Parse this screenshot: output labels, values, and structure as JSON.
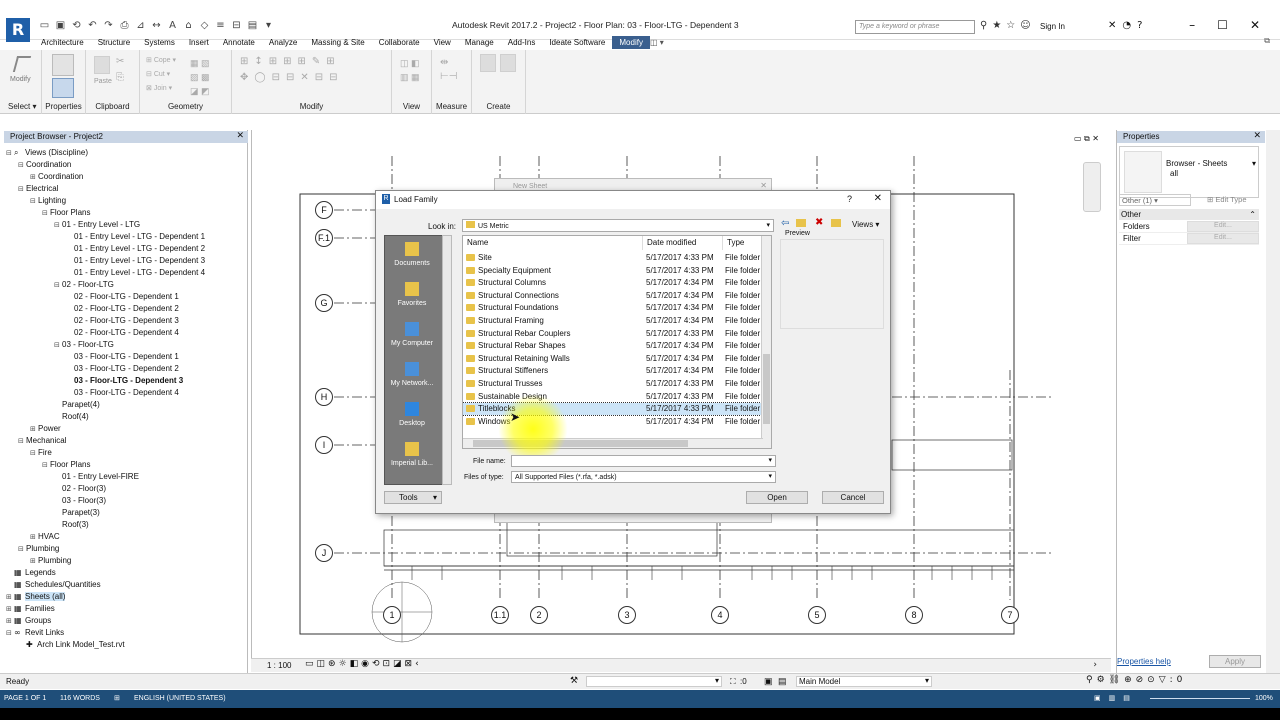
{
  "app": {
    "logo": "R",
    "window_title": "Autodesk Revit 2017.2 -     Project2 - Floor Plan: 03 - Floor-LTG - Dependent 3",
    "search_placeholder": "Type a keyword or phrase",
    "sign_in": "Sign In"
  },
  "tabs": [
    "Architecture",
    "Structure",
    "Systems",
    "Insert",
    "Annotate",
    "Analyze",
    "Massing & Site",
    "Collaborate",
    "View",
    "Manage",
    "Add-Ins",
    "Ideate Software",
    "Modify"
  ],
  "active_tab": "Modify",
  "ribbon": {
    "groups": [
      "Select",
      "Properties",
      "Clipboard",
      "Geometry",
      "Modify",
      "View",
      "Measure",
      "Create"
    ],
    "modify_button": "Modify",
    "paste": "Paste",
    "cope": "Cope",
    "cut": "Cut",
    "join": "Join"
  },
  "project_browser": {
    "title": "Project Browser - Project2",
    "items": [
      {
        "t": "Views (Discipline)",
        "lvl": 0,
        "exp": "−",
        "icon": "views"
      },
      {
        "t": "Coordination",
        "lvl": 1,
        "exp": "−"
      },
      {
        "t": "Coordination",
        "lvl": 2,
        "exp": "+"
      },
      {
        "t": "Electrical",
        "lvl": 1,
        "exp": "−"
      },
      {
        "t": "Lighting",
        "lvl": 2,
        "exp": "−"
      },
      {
        "t": "Floor Plans",
        "lvl": 3,
        "exp": "−"
      },
      {
        "t": "01 - Entry Level - LTG",
        "lvl": 4,
        "exp": "−"
      },
      {
        "t": "01 - Entry Level - LTG - Dependent 1",
        "lvl": 5,
        "exp": ""
      },
      {
        "t": "01 - Entry Level - LTG - Dependent 2",
        "lvl": 5,
        "exp": ""
      },
      {
        "t": "01 - Entry Level - LTG - Dependent 3",
        "lvl": 5,
        "exp": ""
      },
      {
        "t": "01 - Entry Level - LTG - Dependent 4",
        "lvl": 5,
        "exp": ""
      },
      {
        "t": "02 - Floor-LTG",
        "lvl": 4,
        "exp": "−"
      },
      {
        "t": "02 - Floor-LTG - Dependent 1",
        "lvl": 5,
        "exp": ""
      },
      {
        "t": "02 - Floor-LTG - Dependent 2",
        "lvl": 5,
        "exp": ""
      },
      {
        "t": "02 - Floor-LTG - Dependent 3",
        "lvl": 5,
        "exp": ""
      },
      {
        "t": "02 - Floor-LTG - Dependent 4",
        "lvl": 5,
        "exp": ""
      },
      {
        "t": "03 - Floor-LTG",
        "lvl": 4,
        "exp": "−"
      },
      {
        "t": "03 - Floor-LTG - Dependent 1",
        "lvl": 5,
        "exp": ""
      },
      {
        "t": "03 - Floor-LTG - Dependent 2",
        "lvl": 5,
        "exp": ""
      },
      {
        "t": "03 - Floor-LTG - Dependent 3",
        "lvl": 5,
        "exp": "",
        "bold": true
      },
      {
        "t": "03 - Floor-LTG - Dependent 4",
        "lvl": 5,
        "exp": ""
      },
      {
        "t": "Parapet(4)",
        "lvl": 4,
        "exp": ""
      },
      {
        "t": "Roof(4)",
        "lvl": 4,
        "exp": ""
      },
      {
        "t": "Power",
        "lvl": 2,
        "exp": "+"
      },
      {
        "t": "Mechanical",
        "lvl": 1,
        "exp": "−"
      },
      {
        "t": "Fire",
        "lvl": 2,
        "exp": "−"
      },
      {
        "t": "Floor Plans",
        "lvl": 3,
        "exp": "−"
      },
      {
        "t": "01 - Entry Level-FIRE",
        "lvl": 4,
        "exp": ""
      },
      {
        "t": "02 - Floor(3)",
        "lvl": 4,
        "exp": ""
      },
      {
        "t": "03 - Floor(3)",
        "lvl": 4,
        "exp": ""
      },
      {
        "t": "Parapet(3)",
        "lvl": 4,
        "exp": ""
      },
      {
        "t": "Roof(3)",
        "lvl": 4,
        "exp": ""
      },
      {
        "t": "HVAC",
        "lvl": 2,
        "exp": "+"
      },
      {
        "t": "Plumbing",
        "lvl": 1,
        "exp": "−"
      },
      {
        "t": "Plumbing",
        "lvl": 2,
        "exp": "+"
      },
      {
        "t": "Legends",
        "lvl": 0,
        "exp": "",
        "icon": "list"
      },
      {
        "t": "Schedules/Quantities",
        "lvl": 0,
        "exp": "",
        "icon": "list"
      },
      {
        "t": "Sheets (all)",
        "lvl": 0,
        "exp": "+",
        "icon": "list",
        "sel": true
      },
      {
        "t": "Families",
        "lvl": 0,
        "exp": "+",
        "icon": "list"
      },
      {
        "t": "Groups",
        "lvl": 0,
        "exp": "+",
        "icon": "list"
      },
      {
        "t": "Revit Links",
        "lvl": 0,
        "exp": "−",
        "icon": "link"
      },
      {
        "t": "Arch Link Model_Test.rvt",
        "lvl": 1,
        "exp": "",
        "icon": "pin"
      }
    ]
  },
  "grid": {
    "left_bubbles": [
      "F",
      "F.1",
      "G",
      "H",
      "I",
      "J"
    ],
    "bottom_bubbles": [
      "1",
      "1.1",
      "2",
      "3",
      "4",
      "5",
      "8",
      "7"
    ]
  },
  "behind_dialog_title": "New Sheet",
  "dialog": {
    "title": "Load Family",
    "help": "?",
    "look_in_label": "Look in:",
    "look_in_value": "US Metric",
    "views_label": "Views",
    "preview_label": "Preview",
    "places": [
      "Documents",
      "Favorites",
      "My Computer",
      "My Network...",
      "Desktop",
      "Imperial Lib..."
    ],
    "columns": [
      "Name",
      "Date modified",
      "Type"
    ],
    "files": [
      {
        "name": "Site",
        "date": "5/17/2017 4:33 PM",
        "type": "File folder"
      },
      {
        "name": "Specialty Equipment",
        "date": "5/17/2017 4:33 PM",
        "type": "File folder"
      },
      {
        "name": "Structural Columns",
        "date": "5/17/2017 4:34 PM",
        "type": "File folder"
      },
      {
        "name": "Structural Connections",
        "date": "5/17/2017 4:34 PM",
        "type": "File folder"
      },
      {
        "name": "Structural Foundations",
        "date": "5/17/2017 4:34 PM",
        "type": "File folder"
      },
      {
        "name": "Structural Framing",
        "date": "5/17/2017 4:34 PM",
        "type": "File folder"
      },
      {
        "name": "Structural Rebar Couplers",
        "date": "5/17/2017 4:33 PM",
        "type": "File folder"
      },
      {
        "name": "Structural Rebar Shapes",
        "date": "5/17/2017 4:34 PM",
        "type": "File folder"
      },
      {
        "name": "Structural Retaining Walls",
        "date": "5/17/2017 4:34 PM",
        "type": "File folder"
      },
      {
        "name": "Structural Stiffeners",
        "date": "5/17/2017 4:34 PM",
        "type": "File folder"
      },
      {
        "name": "Structural Trusses",
        "date": "5/17/2017 4:33 PM",
        "type": "File folder"
      },
      {
        "name": "Sustainable Design",
        "date": "5/17/2017 4:33 PM",
        "type": "File folder"
      },
      {
        "name": "Titleblocks",
        "date": "5/17/2017 4:33 PM",
        "type": "File folder",
        "selected": true
      },
      {
        "name": "Windows",
        "date": "5/17/2017 4:34 PM",
        "type": "File folder"
      }
    ],
    "file_name_label": "File name:",
    "file_name_value": "",
    "files_of_type_label": "Files of type:",
    "files_of_type_value": "All Supported Files (*.rfa, *.adsk)",
    "tools": "Tools",
    "open": "Open",
    "cancel": "Cancel"
  },
  "properties": {
    "title": "Properties",
    "type_name": "Browser - Sheets",
    "type_sub": "all",
    "selector": "Other (1)",
    "edit_type": "Edit Type",
    "category": "Other",
    "rows": [
      {
        "label": "Folders",
        "value": "Edit..."
      },
      {
        "label": "Filter",
        "value": "Edit..."
      }
    ],
    "help_link": "Properties help",
    "apply": "Apply"
  },
  "viewbar": {
    "scale": "1 : 100"
  },
  "status": {
    "ready": "Ready",
    "coord": ":0",
    "model": "Main Model"
  },
  "word_taskbar": {
    "page": "PAGE 1 OF 1",
    "words": "116 WORDS",
    "lang": "ENGLISH (UNITED STATES)",
    "zoom": "100%"
  },
  "colors": {
    "active_tab": "#3a5f8e",
    "panel_header": "#c9d5e5",
    "folder": "#e8c34a",
    "selection": "#cce4f7",
    "cursor_highlight": "#ffff00",
    "taskbar": "#1f4e79"
  }
}
